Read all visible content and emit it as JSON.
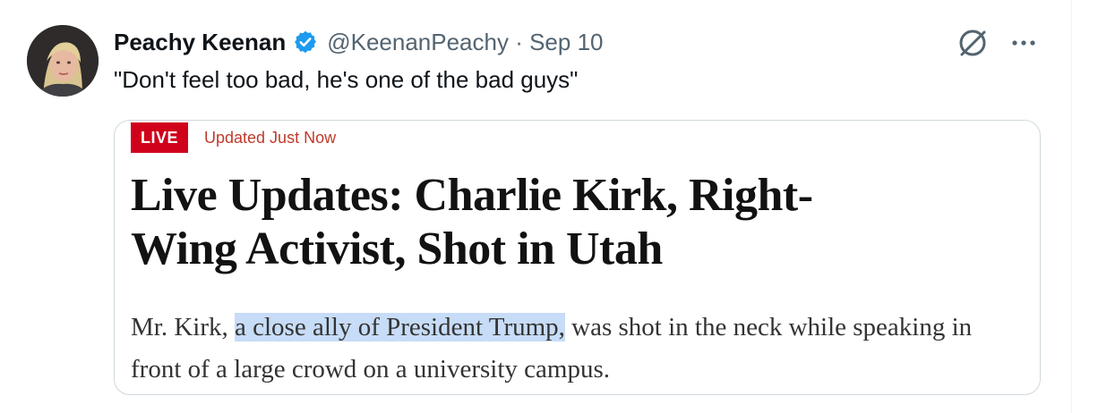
{
  "tweet": {
    "author_name": "Peachy Keenan",
    "handle_date": "@KeenanPeachy · Sep 10",
    "text": "\"Don't feel too bad, he's one of the bad guys\""
  },
  "card": {
    "live_badge": "LIVE",
    "updated_label": "Updated Just Now",
    "headline_line1": "Live Updates: Charlie Kirk, Right-",
    "headline_line2": "Wing Activist, Shot in Utah",
    "summary_before": "Mr. Kirk, ",
    "summary_highlight": "a close ally of President Trump,",
    "summary_after": " was shot in the neck while speaking in front of a large crowd on a university campus."
  },
  "colors": {
    "verified_blue": "#1d9bf0",
    "live_red": "#d0021b",
    "highlight_blue": "#c7dcf7",
    "secondary_text": "#536471"
  },
  "icons": {
    "verified": "verified-badge-icon",
    "grok": "grok-icon",
    "more": "more-icon"
  }
}
